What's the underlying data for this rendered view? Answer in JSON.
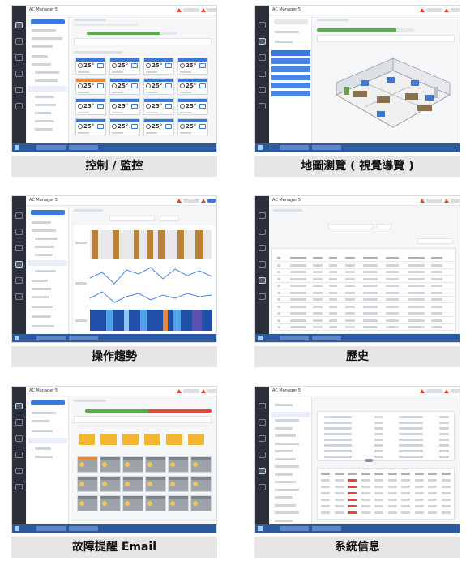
{
  "captions": [
    "控制 / 監控",
    "地圖瀏覽 ( 視覺導覽 )",
    "操作趨勢",
    "歷史",
    "故障提醒 Email",
    "系統信息"
  ],
  "screens": {
    "control": {
      "app_title": "AC Manager 5",
      "tile_readout": "25",
      "tile_unit": "°",
      "tile_header_colors": [
        "#3b79d8",
        "#3b79d8",
        "#3b79d8",
        "#3b79d8",
        "#e8893a",
        "#3b79d8",
        "#3b79d8",
        "#3b79d8",
        "#3b79d8",
        "#3b79d8",
        "#3b79d8",
        "#3b79d8",
        "#3b79d8",
        "#3b79d8",
        "#3b79d8",
        "#3b79d8"
      ],
      "progress_fraction": 0.8
    },
    "map": {
      "app_title": "AC Manager 5",
      "progress_fraction": 0.82
    },
    "trend": {
      "app_title": "AC Manager 5"
    },
    "history": {
      "app_title": "AC Manager 5",
      "row_count": 11
    },
    "email": {
      "app_title": "AC Manager 5",
      "progress_fraction": 0.5
    },
    "sysinfo": {
      "app_title": "AC Manager 5"
    }
  },
  "colors": {
    "accent_blue": "#3b79d8",
    "sidebar": "#2a2f3a",
    "taskbar": "#2c5aa0",
    "ok_green": "#55b04a",
    "alarm_orange": "#e8893a",
    "alarm_red": "#e0492e",
    "folder_yellow": "#f2b632",
    "bar_brown": "#b98235"
  },
  "icons": {
    "warning": "warning-triangle-icon",
    "folder": "folder-icon",
    "ac_unit": "air-conditioner-icon"
  }
}
